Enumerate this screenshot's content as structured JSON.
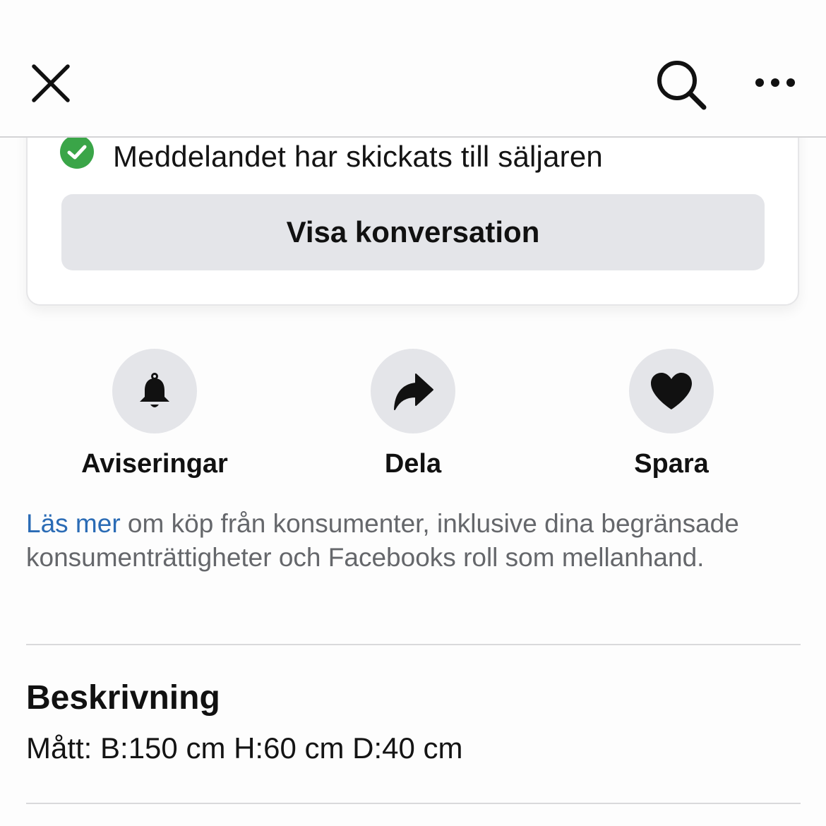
{
  "header": {
    "close_icon": "close-icon",
    "search_icon": "search-icon",
    "more_icon": "more-options-icon"
  },
  "confirmation": {
    "status_icon": "check-circle-icon",
    "status_color": "#3aa548",
    "message": "Meddelandet har skickats till säljaren",
    "button_label": "Visa konversation"
  },
  "actions": [
    {
      "icon": "bell-icon",
      "label": "Aviseringar"
    },
    {
      "icon": "share-icon",
      "label": "Dela"
    },
    {
      "icon": "heart-icon",
      "label": "Spara"
    }
  ],
  "info": {
    "link_text": "Läs mer",
    "body": " om köp från konsumenter, inklusive dina begränsade konsumenträttigheter och Facebooks roll som mellanhand.",
    "link_color": "#2a6bb5"
  },
  "description": {
    "title": "Beskrivning",
    "text": "Mått: B:150 cm H:60 cm D:40 cm"
  }
}
